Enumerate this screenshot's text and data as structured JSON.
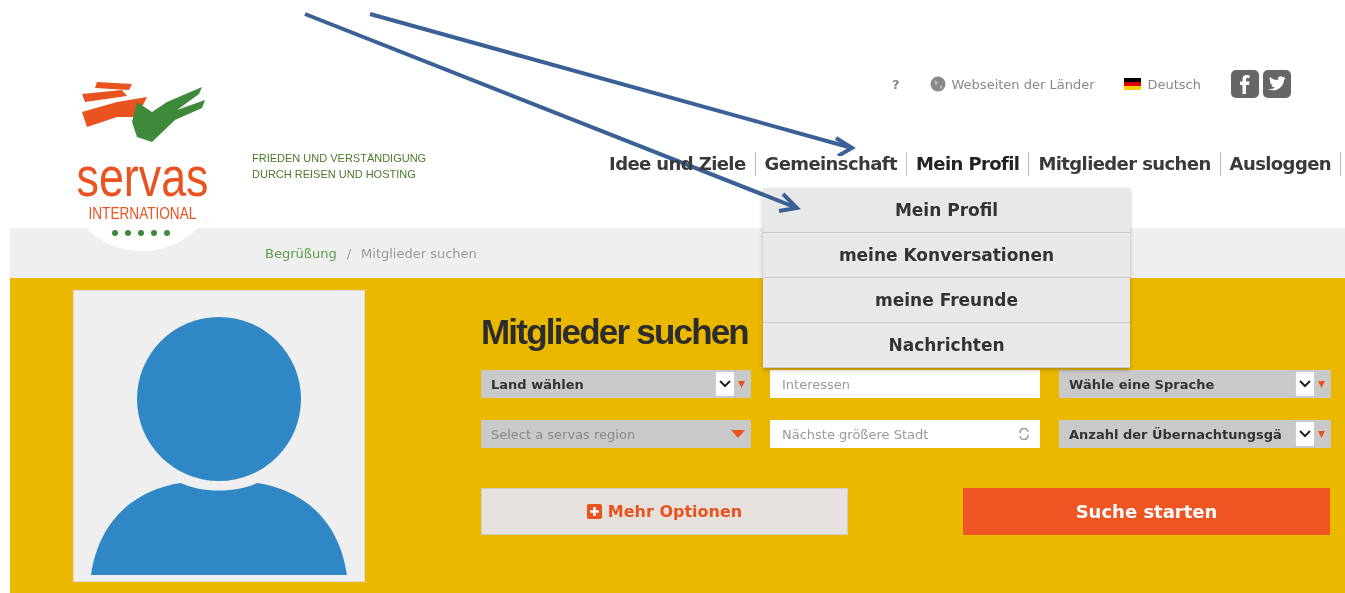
{
  "logo": {
    "name": "servas",
    "subtitle": "INTERNATIONAL"
  },
  "tagline": [
    "FRIEDEN UND VERSTÄNDIGUNG",
    "DURCH REISEN UND HOSTING"
  ],
  "utility": {
    "help": "?",
    "countries": "Webseiten der Länder",
    "language": "Deutsch"
  },
  "nav": [
    {
      "label": "Idee und Ziele",
      "selected": false
    },
    {
      "label": "Gemeinschaft",
      "selected": false
    },
    {
      "label": "Mein Profil",
      "selected": true
    },
    {
      "label": "Mitglieder suchen",
      "selected": false
    },
    {
      "label": "Ausloggen",
      "selected": false
    }
  ],
  "profile_menu": [
    "Mein Profil",
    "meine Konversationen",
    "meine Freunde",
    "Nachrichten"
  ],
  "breadcrumb": [
    "Begrüßung",
    "/",
    "Mitglieder suchen"
  ],
  "heading": "Mitglieder suchen",
  "filters": [
    {
      "kind": "select",
      "value": "Land wählen"
    },
    {
      "kind": "input",
      "placeholder": "Interessen"
    },
    {
      "kind": "select",
      "value": "Wähle eine Sprache"
    },
    {
      "kind": "region",
      "placeholder": "Select a servas region"
    },
    {
      "kind": "spin",
      "placeholder": "Nächste größere Stadt"
    },
    {
      "kind": "select",
      "value": "Anzahl der Übernachtungsgä"
    }
  ],
  "more_button": "Mehr Optionen",
  "search_button": "Suche starten"
}
